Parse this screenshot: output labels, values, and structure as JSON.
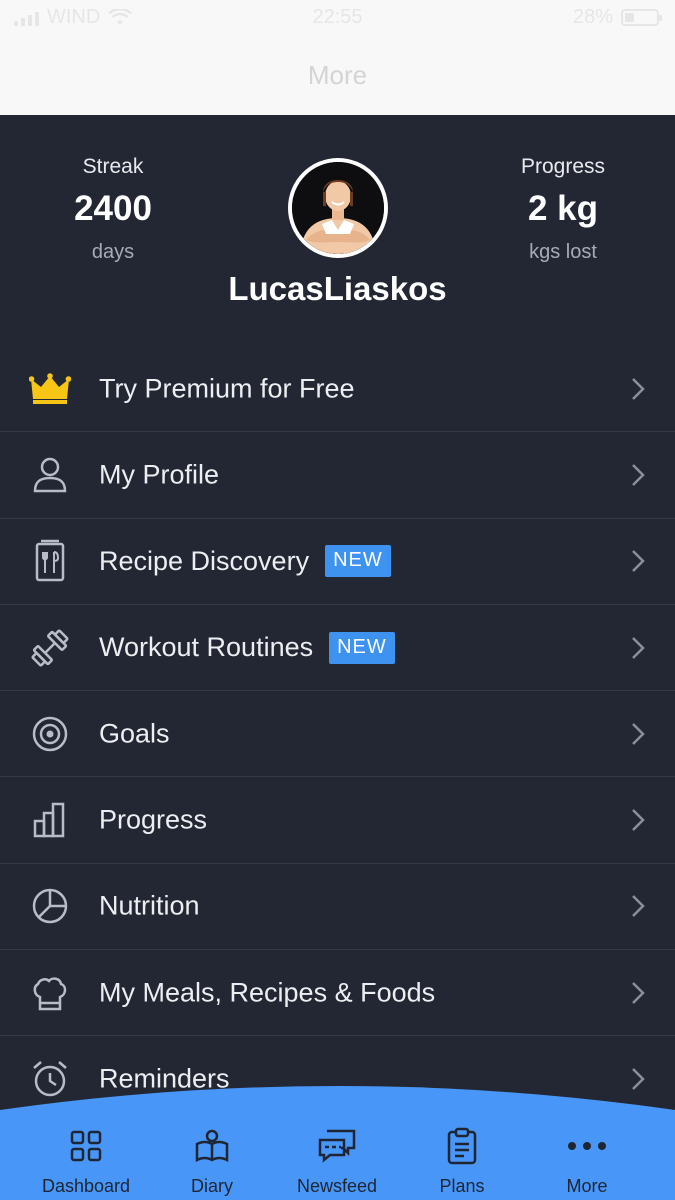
{
  "status_bar": {
    "carrier": "WIND",
    "time": "22:55",
    "battery": "28%"
  },
  "header": {
    "title": "More"
  },
  "profile": {
    "streak": {
      "label": "Streak",
      "value": "2400",
      "unit": "days"
    },
    "progress": {
      "label": "Progress",
      "value": "2 kg",
      "unit": "kgs lost"
    },
    "username": "LucasLiaskos"
  },
  "menu": {
    "items": [
      {
        "label": "Try Premium for Free",
        "icon": "crown-icon"
      },
      {
        "label": "My Profile",
        "icon": "person-icon"
      },
      {
        "label": "Recipe Discovery",
        "icon": "recipe-book-icon",
        "badge": "NEW"
      },
      {
        "label": "Workout Routines",
        "icon": "dumbbell-icon",
        "badge": "NEW"
      },
      {
        "label": "Goals",
        "icon": "target-icon"
      },
      {
        "label": "Progress",
        "icon": "bar-chart-icon"
      },
      {
        "label": "Nutrition",
        "icon": "pie-chart-icon"
      },
      {
        "label": "My Meals, Recipes & Foods",
        "icon": "chef-hat-icon"
      },
      {
        "label": "Reminders",
        "icon": "alarm-clock-icon"
      }
    ]
  },
  "tabbar": {
    "tabs": [
      {
        "label": "Dashboard",
        "icon": "dashboard-icon"
      },
      {
        "label": "Diary",
        "icon": "diary-icon"
      },
      {
        "label": "Newsfeed",
        "icon": "chat-icon"
      },
      {
        "label": "Plans",
        "icon": "clipboard-icon"
      },
      {
        "label": "More",
        "icon": "more-dots-icon",
        "active": true
      }
    ]
  },
  "colors": {
    "background": "#232733",
    "accent": "#3f93f0",
    "nav_background": "#4896f8",
    "crown": "#f6c515"
  }
}
